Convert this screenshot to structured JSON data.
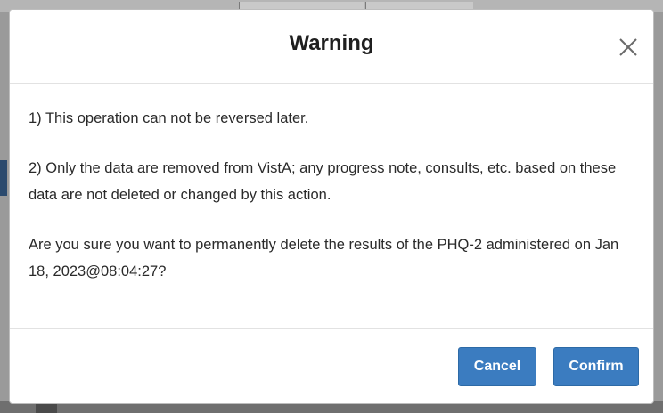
{
  "dialog": {
    "title": "Warning",
    "close_icon": "close-icon",
    "paragraphs": [
      "1) This operation can not be reversed later.",
      "2) Only the data are removed from VistA; any progress note, consults, etc. based on these data are not deleted or changed by this action.",
      "Are you sure you want to permanently delete the results of the PHQ-2 administered on Jan 18, 2023@08:04:27?"
    ],
    "buttons": {
      "cancel_label": "Cancel",
      "confirm_label": "Confirm"
    }
  },
  "colors": {
    "primary_button": "#3b7cc0",
    "overlay": "#9a9a9a"
  }
}
